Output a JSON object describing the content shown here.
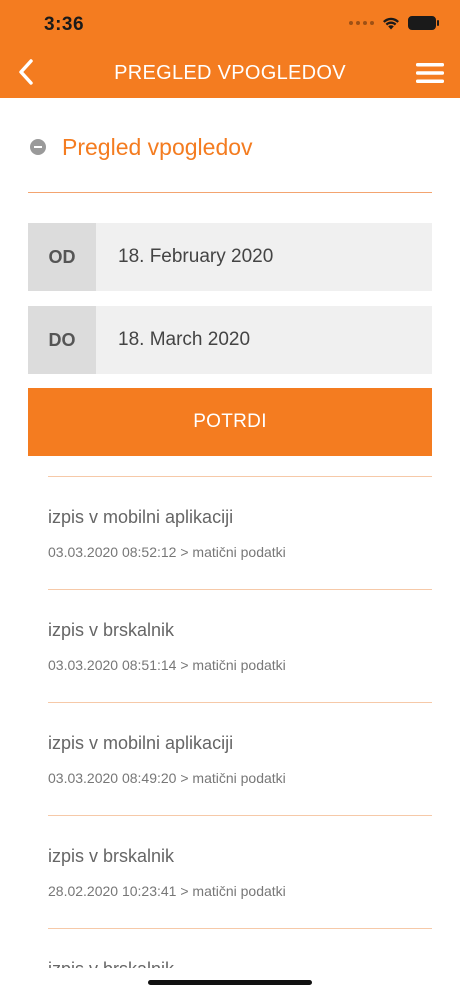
{
  "status_bar": {
    "time": "3:36"
  },
  "header": {
    "title": "PREGLED VPOGLEDOV",
    "back_icon": "chevron-left-icon",
    "menu_icon": "hamburger-menu-icon",
    "background_color": "#f47c20"
  },
  "section": {
    "title": "Pregled vpogledov",
    "collapse_icon": "minus-circle-icon"
  },
  "date_from": {
    "label": "OD",
    "value": "18. February 2020"
  },
  "date_to": {
    "label": "DO",
    "value": "18. March 2020"
  },
  "confirm": {
    "label": "POTRDI"
  },
  "entries": [
    {
      "title": "izpis v mobilni aplikaciji",
      "subtitle": "03.03.2020 08:52:12 > matični podatki"
    },
    {
      "title": "izpis v brskalnik",
      "subtitle": "03.03.2020 08:51:14 > matični podatki"
    },
    {
      "title": "izpis v mobilni aplikaciji",
      "subtitle": "03.03.2020 08:49:20 > matični podatki"
    },
    {
      "title": "izpis v brskalnik",
      "subtitle": "28.02.2020 10:23:41 > matični podatki"
    },
    {
      "title": "izpis v brskalnik",
      "subtitle": ""
    }
  ],
  "colors": {
    "accent": "#f47c20",
    "divider": "#f6c9a8"
  }
}
